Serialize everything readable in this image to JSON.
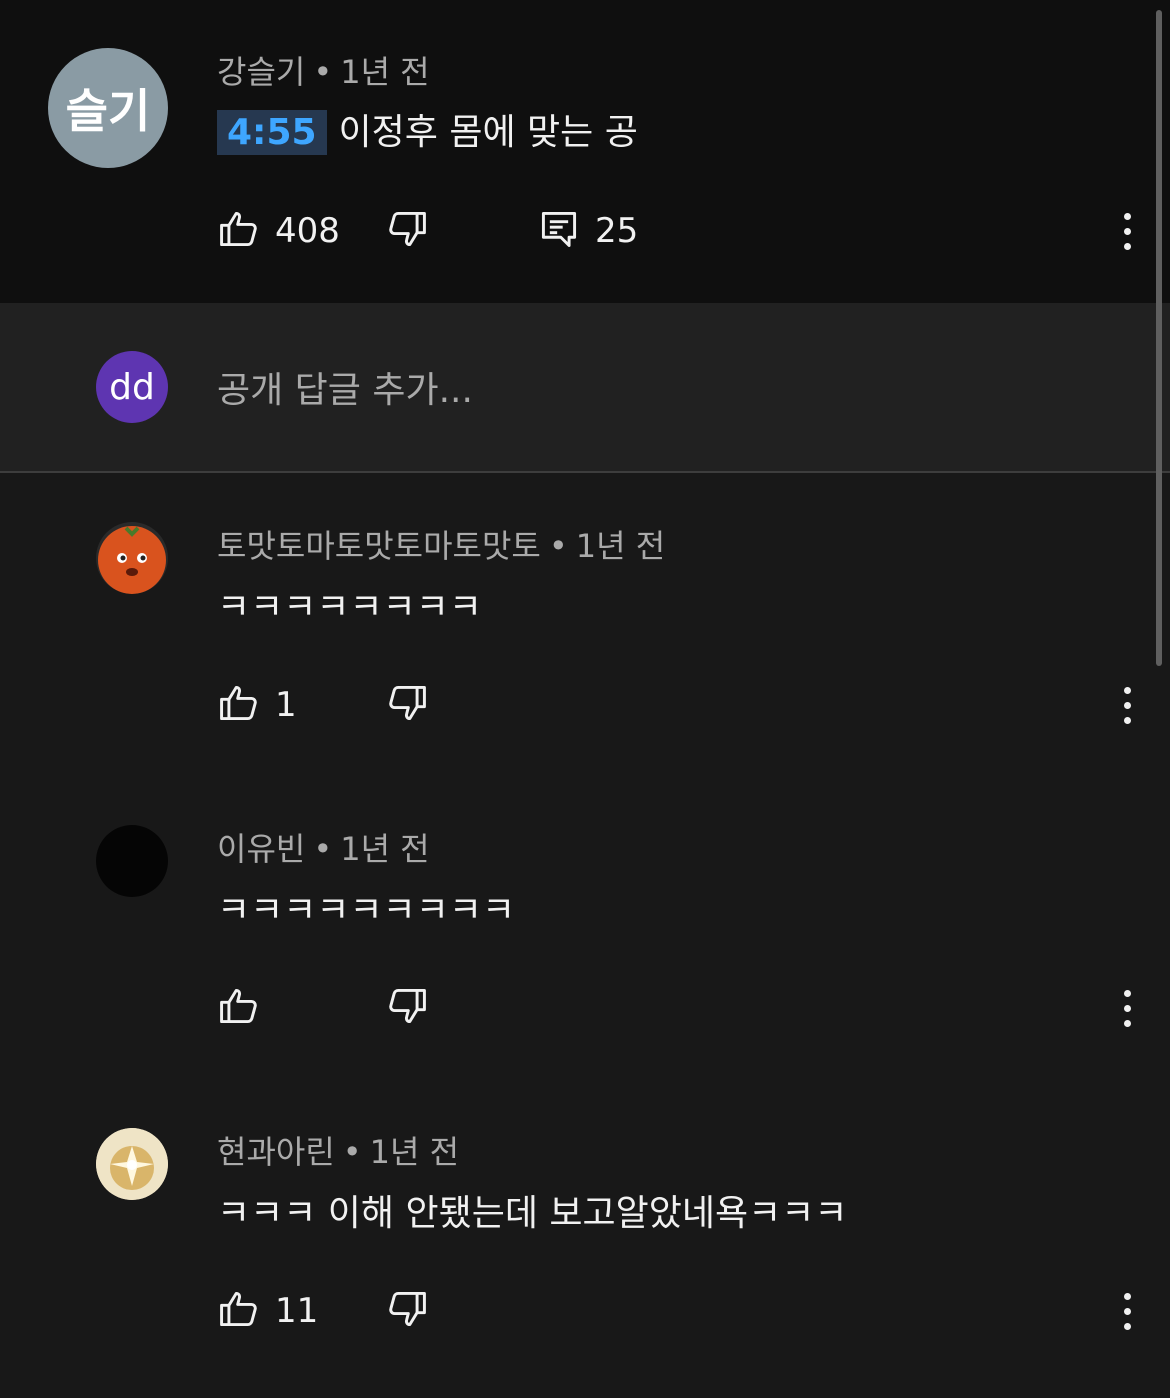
{
  "main_comment": {
    "avatar_text": "슬기",
    "author": "강슬기",
    "time": "1년 전",
    "timestamp": "4:55",
    "text": "이정후 몸에 맞는 공",
    "likes": "408",
    "replies": "25"
  },
  "reply_input": {
    "avatar_text": "dd",
    "placeholder": "공개 답글 추가..."
  },
  "replies": [
    {
      "author": "토맛토마토맛토마토맛토",
      "time": "1년 전",
      "text": "ㅋㅋㅋㅋㅋㅋㅋㅋ",
      "likes": "1"
    },
    {
      "author": "이유빈",
      "time": "1년 전",
      "text": "ㅋㅋㅋㅋㅋㅋㅋㅋㅋ",
      "likes": ""
    },
    {
      "author": "현과아린",
      "time": "1년 전",
      "text": "ㅋㅋㅋ 이해 안됐는데 보고알았네욕ㅋㅋㅋ",
      "likes": "11"
    }
  ],
  "separator": "•",
  "icons": {
    "like": "thumbs-up-icon",
    "dislike": "thumbs-down-icon",
    "reply": "comment-icon",
    "more": "more-vertical-icon"
  },
  "colors": {
    "background": "#181818",
    "main_background": "#0f0f0f",
    "timestamp_link": "#3ea6ff",
    "avatar_main": "#8a9ba4",
    "avatar_dd": "#5e35b1"
  }
}
